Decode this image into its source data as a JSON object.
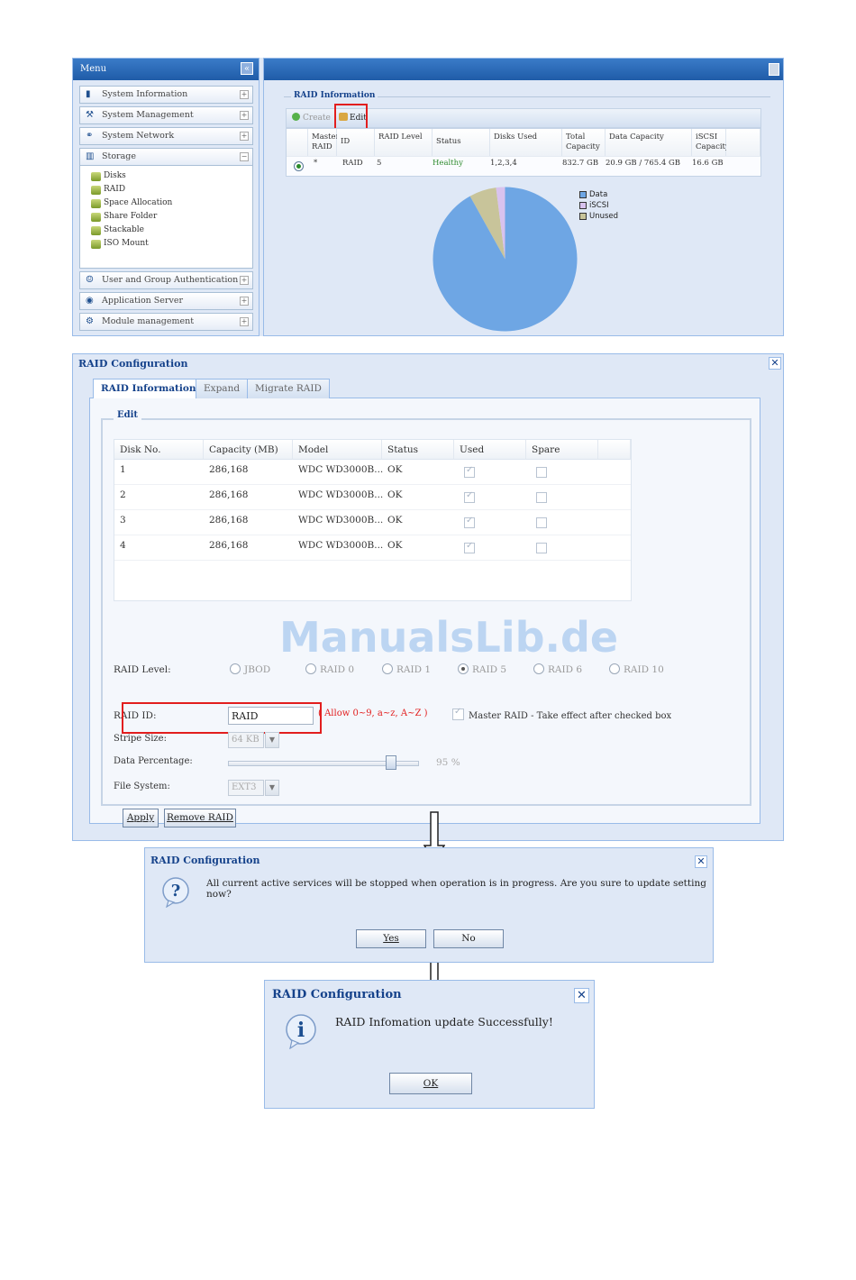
{
  "main_ui": {
    "menu": {
      "title": "Menu",
      "collapse_glyph": "«",
      "items": [
        {
          "label": "System Information",
          "icon": "info-icon",
          "expander": "+"
        },
        {
          "label": "System Management",
          "icon": "wrench-icon",
          "expander": "+"
        },
        {
          "label": "System Network",
          "icon": "network-icon",
          "expander": "+"
        },
        {
          "label": "Storage",
          "icon": "storage-icon",
          "expander": "−"
        },
        {
          "label": "User and Group Authentication",
          "icon": "user-group-icon",
          "expander": "+"
        },
        {
          "label": "Application Server",
          "icon": "application-server-icon",
          "expander": "+"
        },
        {
          "label": "Module management",
          "icon": "module-icon",
          "expander": "+"
        }
      ],
      "storage_sub": [
        "Disks",
        "RAID",
        "Space Allocation",
        "Share Folder",
        "Stackable",
        "ISO Mount"
      ]
    },
    "raid_info": {
      "legend": "RAID Information",
      "toolbar": {
        "create": "Create",
        "edit": "Edit"
      },
      "columns": [
        "Master RAID",
        "ID",
        "RAID Level",
        "Status",
        "Disks Used",
        "Total Capacity",
        "Data Capacity",
        "iSCSI Capacity"
      ],
      "row": {
        "master": "*",
        "id": "RAID",
        "level": "5",
        "status": "Healthy",
        "disks": "1,2,3,4",
        "total": "832.7 GB",
        "data": "20.9 GB / 765.4 GB",
        "iscsi": "16.6 GB"
      },
      "status_color": "#2e8b2e"
    },
    "chart_data": {
      "type": "pie",
      "title": "",
      "labels": [
        "Data",
        "iSCSI",
        "Unused"
      ],
      "values": [
        765.4,
        16.6,
        50.7
      ],
      "colors": [
        "#6ea6e4",
        "#d8c2ee",
        "#c8c49a"
      ],
      "legend_position": "right"
    }
  },
  "raid_config": {
    "title": "RAID Configuration",
    "tabs": [
      "RAID Information",
      "Expand",
      "Migrate RAID"
    ],
    "edit_legend": "Edit",
    "disk_columns": [
      "Disk No.",
      "Capacity (MB)",
      "Model",
      "Status",
      "Used",
      "Spare"
    ],
    "disks": [
      {
        "no": "1",
        "capacity": "286,168",
        "model": "WDC WD3000B...",
        "status": "OK",
        "used": true,
        "spare": false
      },
      {
        "no": "2",
        "capacity": "286,168",
        "model": "WDC WD3000B...",
        "status": "OK",
        "used": true,
        "spare": false
      },
      {
        "no": "3",
        "capacity": "286,168",
        "model": "WDC WD3000B...",
        "status": "OK",
        "used": true,
        "spare": false
      },
      {
        "no": "4",
        "capacity": "286,168",
        "model": "WDC WD3000B...",
        "status": "OK",
        "used": true,
        "spare": false
      }
    ],
    "watermark": "ManualsLib.de",
    "raid_level_label": "RAID Level:",
    "raid_levels": [
      "JBOD",
      "RAID 0",
      "RAID 1",
      "RAID 5",
      "RAID 6",
      "RAID 10"
    ],
    "selected_level": "RAID 5",
    "raid_id_label": "RAID ID:",
    "raid_id_value": "RAID",
    "raid_id_hint": "( Allow 0~9, a~z, A~Z )",
    "master_raid_label": "Master RAID - Take effect after checked box",
    "master_raid_checked": true,
    "stripe_size_label": "Stripe Size:",
    "stripe_size_value": "64 KB",
    "data_percentage_label": "Data Percentage:",
    "data_percentage_value": "95 %",
    "data_percentage_fraction": 0.95,
    "file_system_label": "File System:",
    "file_system_value": "EXT3",
    "apply_label": "Apply",
    "remove_label": "Remove RAID"
  },
  "confirm_dialog": {
    "title": "RAID Configuration",
    "message": "All current active services will be stopped when operation is in progress. Are you sure to update setting now?",
    "yes_label": "Yes",
    "no_label": "No"
  },
  "success_dialog": {
    "title": "RAID Configuration",
    "message": "RAID Infomation update Successfully!",
    "ok_label": "OK"
  },
  "colors": {
    "accent": "#15428b",
    "highlight": "#e21e1e",
    "header_blue": "#1f5ca8"
  }
}
